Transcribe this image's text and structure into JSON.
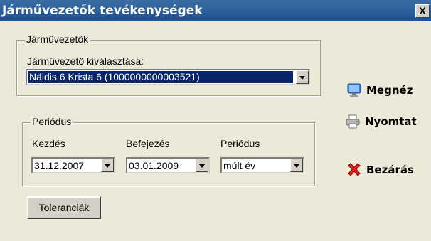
{
  "window": {
    "title": "Járművezetők tevékenységek",
    "close_label": "X"
  },
  "drivers_group": {
    "legend": "Járművezetők",
    "select_label": "Járművezető kiválasztása:",
    "selected_value": "Näidis 6 Krista 6 (1000000000003521)"
  },
  "period_group": {
    "legend": "Periódus",
    "start_label": "Kezdés",
    "start_value": "31.12.2007",
    "end_label": "Befejezés",
    "end_value": "03.01.2009",
    "period_label": "Periódus",
    "period_value": "múlt év"
  },
  "buttons": {
    "tolerances": "Toleranciák",
    "view": "Megnéz",
    "print": "Nyomtat",
    "close": "Bezárás"
  },
  "icons": {
    "view": "monitor-icon",
    "print": "printer-icon",
    "close": "red-x-icon"
  }
}
